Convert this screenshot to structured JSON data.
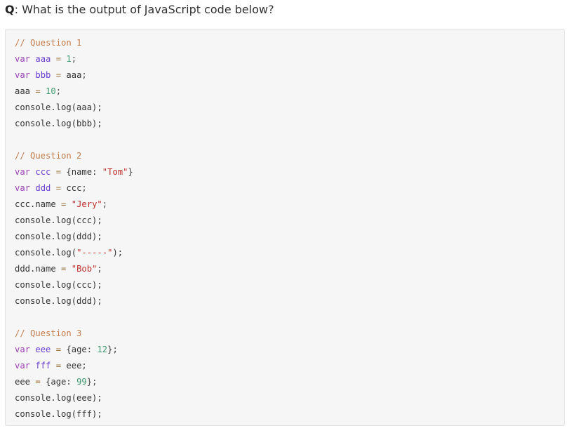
{
  "question": {
    "label": "Q",
    "text": ": What is the output of JavaScript code below?"
  },
  "colors": {
    "comment": "#c67e4d",
    "keyword": "#9b41b6",
    "variable": "#6a3fd1",
    "operator": "#9a6e3a",
    "number": "#3d9970",
    "string": "#c0302e",
    "plain": "#333333",
    "code_background": "#f6f6f6"
  },
  "code": {
    "lines": [
      [
        {
          "t": "// Question 1",
          "c": "comment"
        }
      ],
      [
        {
          "t": "var",
          "c": "keyword"
        },
        {
          "t": " "
        },
        {
          "t": "aaa",
          "c": "var"
        },
        {
          "t": " "
        },
        {
          "t": "=",
          "c": "op"
        },
        {
          "t": " "
        },
        {
          "t": "1",
          "c": "number"
        },
        {
          "t": ";",
          "c": "punct"
        }
      ],
      [
        {
          "t": "var",
          "c": "keyword"
        },
        {
          "t": " "
        },
        {
          "t": "bbb",
          "c": "var"
        },
        {
          "t": " "
        },
        {
          "t": "=",
          "c": "op"
        },
        {
          "t": " aaa"
        },
        {
          "t": ";",
          "c": "punct"
        }
      ],
      [
        {
          "t": "aaa "
        },
        {
          "t": "=",
          "c": "op"
        },
        {
          "t": " "
        },
        {
          "t": "10",
          "c": "number"
        },
        {
          "t": ";",
          "c": "punct"
        }
      ],
      [
        {
          "t": "console.log(aaa);"
        }
      ],
      [
        {
          "t": "console.log(bbb);"
        }
      ],
      [],
      [
        {
          "t": "// Question 2",
          "c": "comment"
        }
      ],
      [
        {
          "t": "var",
          "c": "keyword"
        },
        {
          "t": " "
        },
        {
          "t": "ccc",
          "c": "var"
        },
        {
          "t": " "
        },
        {
          "t": "=",
          "c": "op"
        },
        {
          "t": " {name: "
        },
        {
          "t": "\"Tom\"",
          "c": "string"
        },
        {
          "t": "}",
          "c": "punct"
        }
      ],
      [
        {
          "t": "var",
          "c": "keyword"
        },
        {
          "t": " "
        },
        {
          "t": "ddd",
          "c": "var"
        },
        {
          "t": " "
        },
        {
          "t": "=",
          "c": "op"
        },
        {
          "t": " ccc"
        },
        {
          "t": ";",
          "c": "punct"
        }
      ],
      [
        {
          "t": "ccc.name "
        },
        {
          "t": "=",
          "c": "op"
        },
        {
          "t": " "
        },
        {
          "t": "\"Jery\"",
          "c": "string"
        },
        {
          "t": ";",
          "c": "punct"
        }
      ],
      [
        {
          "t": "console.log(ccc);"
        }
      ],
      [
        {
          "t": "console.log(ddd);"
        }
      ],
      [
        {
          "t": "console.log("
        },
        {
          "t": "\"-----\"",
          "c": "string"
        },
        {
          "t": ");"
        }
      ],
      [
        {
          "t": "ddd.name "
        },
        {
          "t": "=",
          "c": "op"
        },
        {
          "t": " "
        },
        {
          "t": "\"Bob\"",
          "c": "string"
        },
        {
          "t": ";",
          "c": "punct"
        }
      ],
      [
        {
          "t": "console.log(ccc);"
        }
      ],
      [
        {
          "t": "console.log(ddd);"
        }
      ],
      [],
      [
        {
          "t": "// Question 3",
          "c": "comment"
        }
      ],
      [
        {
          "t": "var",
          "c": "keyword"
        },
        {
          "t": " "
        },
        {
          "t": "eee",
          "c": "var"
        },
        {
          "t": " "
        },
        {
          "t": "=",
          "c": "op"
        },
        {
          "t": " {age: "
        },
        {
          "t": "12",
          "c": "number"
        },
        {
          "t": "};",
          "c": "punct"
        }
      ],
      [
        {
          "t": "var",
          "c": "keyword"
        },
        {
          "t": " "
        },
        {
          "t": "fff",
          "c": "var"
        },
        {
          "t": " "
        },
        {
          "t": "=",
          "c": "op"
        },
        {
          "t": " eee"
        },
        {
          "t": ";",
          "c": "punct"
        }
      ],
      [
        {
          "t": "eee "
        },
        {
          "t": "=",
          "c": "op"
        },
        {
          "t": " {age: "
        },
        {
          "t": "99",
          "c": "number"
        },
        {
          "t": "};",
          "c": "punct"
        }
      ],
      [
        {
          "t": "console.log(eee);"
        }
      ],
      [
        {
          "t": "console.log(fff);"
        }
      ]
    ]
  }
}
